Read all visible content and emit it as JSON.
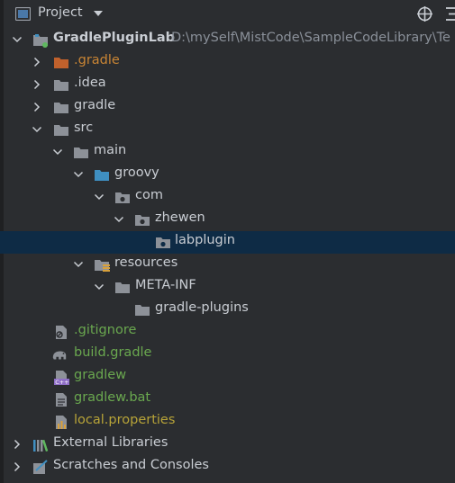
{
  "header": {
    "title": "Project",
    "icon": "project-panel-icon",
    "chevron": "chevron-down-icon",
    "target_icon": "locate-target-icon",
    "more_icon": "more-icon"
  },
  "tree": {
    "root": {
      "label": "GradlePluginLab",
      "path": "D:\\mySelf\\MistCode\\SampleCodeLibrary\\Te"
    },
    "items": [
      {
        "label": ".gradle"
      },
      {
        "label": ".idea"
      },
      {
        "label": "gradle"
      },
      {
        "label": "src"
      },
      {
        "label": "main"
      },
      {
        "label": "groovy"
      },
      {
        "label": "com"
      },
      {
        "label": "zhewen"
      },
      {
        "label": "labplugin"
      },
      {
        "label": "resources"
      },
      {
        "label": "META-INF"
      },
      {
        "label": "gradle-plugins"
      },
      {
        "label": ".gitignore"
      },
      {
        "label": "build.gradle"
      },
      {
        "label": "gradlew"
      },
      {
        "label": "gradlew.bat"
      },
      {
        "label": "local.properties"
      },
      {
        "label": "External Libraries"
      },
      {
        "label": "Scratches and Consoles"
      }
    ]
  },
  "colors": {
    "background": "#2b2d30",
    "selection": "#0e2b45",
    "text": "#c9cdd3",
    "git_added": "#6aa84f",
    "excluded": "#c98534",
    "ignored": "#b7a338",
    "folder": "#8d9198",
    "source_folder": "#3f8fc1"
  }
}
